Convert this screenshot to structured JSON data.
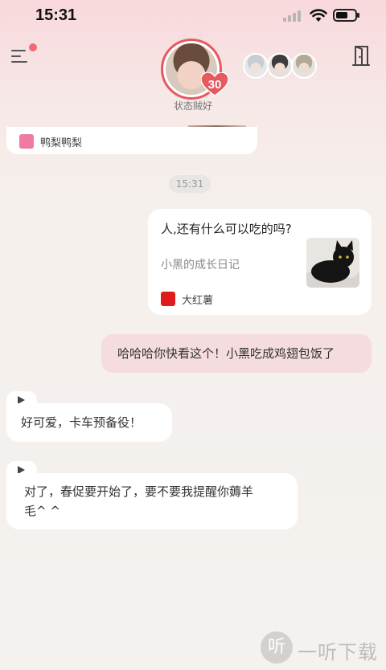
{
  "status_bar": {
    "time": "15:31"
  },
  "header": {
    "mood_text": "状态贼好",
    "affection_level": "30"
  },
  "chat": {
    "previous_source": "鸭梨鸭梨",
    "timestamp": "15:31",
    "shared_post": {
      "title": "人,还有什么可以吃的吗?",
      "description": "小黑的成长日记",
      "source": "大红薯"
    },
    "user_message": "哈哈哈你快看这个！小黑吃成鸡翅包饭了",
    "reply_1": "好可爱，卡车预备役！",
    "reply_2_line1": "对了，春促要开始了，要不要我提醒你薅羊",
    "reply_2_line2": "毛^ ^"
  },
  "watermark": {
    "glyph": "听",
    "text": "一听下载"
  },
  "colors": {
    "accent": "#e65a5f",
    "user_bubble": "#f5dcde",
    "source_icon_pink": "#ef7aa3",
    "source_icon_red": "#e01b1b"
  },
  "icons": [
    "menu-icon",
    "exit-door-icon",
    "heart-icon",
    "play-icon",
    "signal-icon",
    "wifi-icon",
    "battery-icon"
  ]
}
